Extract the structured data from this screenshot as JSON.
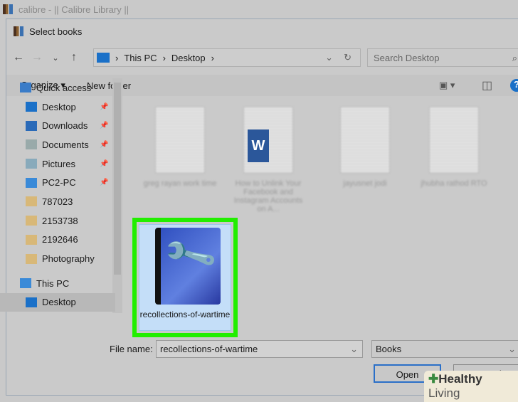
{
  "app": {
    "title": "calibre - || Calibre Library ||"
  },
  "dialog": {
    "title": "Select books"
  },
  "nav": {
    "back": "←",
    "forward": "→",
    "recent": "⌄",
    "up": "↑",
    "path": [
      "This PC",
      "Desktop"
    ],
    "sep": "›",
    "refresh": "↻",
    "dropdown": "⌄",
    "search_placeholder": "Search Desktop",
    "search_icon": "⌕"
  },
  "toolbar": {
    "organize": "Organize ▾",
    "new_folder": "New folder",
    "view": "▣ ▾",
    "pane": "◫",
    "help": "?"
  },
  "sidebar": {
    "items": [
      {
        "label": "Quick access",
        "icon": "star-icon",
        "top": true
      },
      {
        "label": "Desktop",
        "icon": "desktop-icon",
        "pinned": true
      },
      {
        "label": "Downloads",
        "icon": "download-icon",
        "pinned": true
      },
      {
        "label": "Documents",
        "icon": "documents-icon",
        "pinned": true
      },
      {
        "label": "Pictures",
        "icon": "pictures-icon",
        "pinned": true
      },
      {
        "label": "PC2-PC",
        "icon": "computer-icon",
        "pinned": true
      },
      {
        "label": "787023",
        "icon": "folder-icon"
      },
      {
        "label": "2153738",
        "icon": "folder-icon"
      },
      {
        "label": "2192646",
        "icon": "folder-icon"
      },
      {
        "label": "Photography",
        "icon": "folder-icon"
      },
      {
        "label": "This PC",
        "icon": "computer-icon",
        "top": true
      },
      {
        "label": "Desktop",
        "icon": "desktop-icon",
        "selected": true
      }
    ],
    "pin": "📌"
  },
  "files": [
    {
      "name": "greg rayan work time"
    },
    {
      "name": "How to Unlink Your Facebook and Instagram Accounts on A...",
      "word": "W"
    },
    {
      "name": "jayusnet jodi"
    },
    {
      "name": "jhubha rathod RTO"
    }
  ],
  "selected_file": {
    "name": "recollections-of-wartime"
  },
  "footer": {
    "file_name_label": "File name:",
    "file_name_value": "recollections-of-wartime",
    "file_type": "Books",
    "open": "Open",
    "cancel": "Cancel"
  },
  "watermark": {
    "text1": "Healthy",
    "text2": " Living",
    "plus": "✚"
  },
  "colors": {
    "highlight": "#22ee00",
    "accent": "#2a6fc8"
  }
}
